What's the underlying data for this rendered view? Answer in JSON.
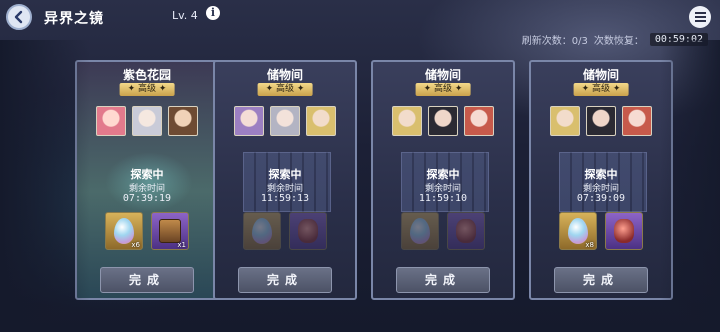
{
  "header": {
    "title": "异界之镜",
    "level": "Lv. 4",
    "info_icon": "i",
    "back_icon": "back-arrow-icon",
    "menu_icon": "hamburger-menu-icon"
  },
  "refresh": {
    "refresh_count_label": "刷新次数：0/3",
    "recover_label": "次数恢复：",
    "recover_timer": "00:59:02"
  },
  "cards": [
    {
      "name": "紫色花园",
      "grade": "✦ 高级 ✦",
      "status": "探索中",
      "remain_label": "剩余时间",
      "remain_time": "07:39:19",
      "rewards": [
        {
          "icon": "egg-icon",
          "qty": "x6"
        },
        {
          "icon": "treasure-box-icon",
          "qty": "x1"
        }
      ],
      "button": "完成"
    },
    {
      "name": "储物间",
      "grade": "✦ 高级 ✦",
      "status": "探索中",
      "remain_label": "剩余时间",
      "remain_time": "11:59:13",
      "rewards": [
        {
          "icon": "egg-icon",
          "qty": ""
        },
        {
          "icon": "gem-icon",
          "qty": ""
        }
      ],
      "button": "完成"
    },
    {
      "name": "储物间",
      "grade": "✦ 高级 ✦",
      "status": "探索中",
      "remain_label": "剩余时间",
      "remain_time": "11:59:10",
      "rewards": [
        {
          "icon": "egg-icon",
          "qty": ""
        },
        {
          "icon": "gem-icon",
          "qty": ""
        }
      ],
      "button": "完成"
    },
    {
      "name": "储物间",
      "grade": "✦ 高级 ✦",
      "status": "探索中",
      "remain_label": "剩余时间",
      "remain_time": "07:39:09",
      "rewards": [
        {
          "icon": "egg-icon",
          "qty": "x8"
        },
        {
          "icon": "gem-icon",
          "qty": ""
        }
      ],
      "button": "完成"
    }
  ]
}
